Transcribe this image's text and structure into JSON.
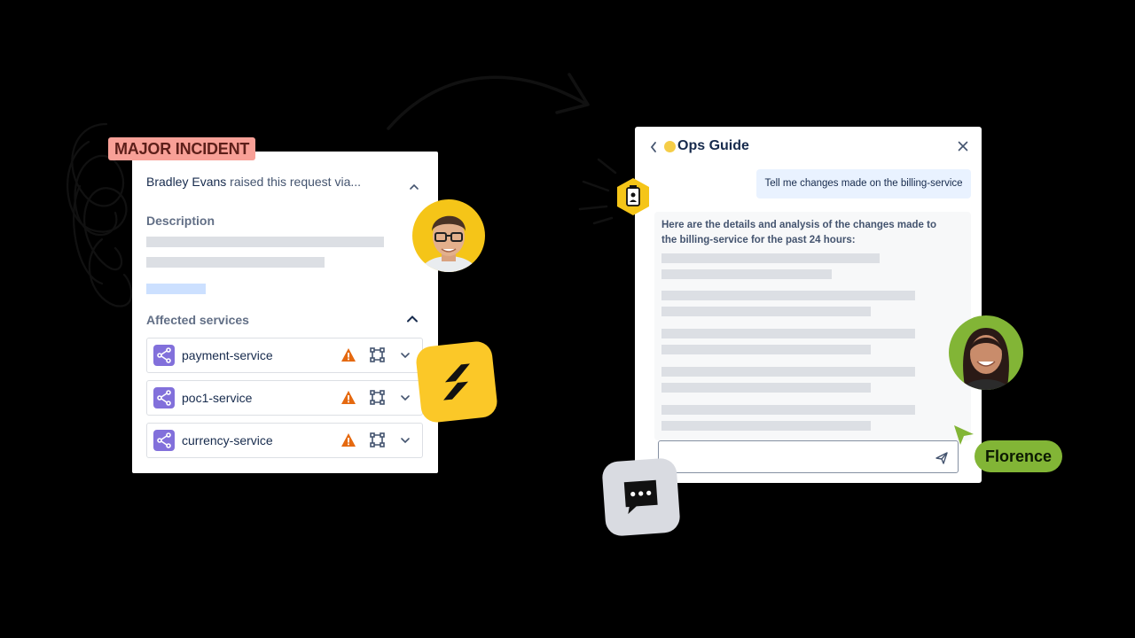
{
  "incident": {
    "badge": "MAJOR INCIDENT",
    "raised_by_name": "Bradley Evans",
    "raised_by_rest": " raised this request via...",
    "description_label": "Description",
    "affected_label": "Affected services",
    "services": [
      {
        "name": "payment-service"
      },
      {
        "name": "poc1-service"
      },
      {
        "name": "currency-service"
      }
    ]
  },
  "ops_guide": {
    "title": "Ops Guide",
    "user_message": "Tell me changes made on the billing-service",
    "ai_message": "Here are the details and analysis of the changes made to the billing-service for the past 24 hours:"
  },
  "florence": {
    "name": "Florence"
  },
  "colors": {
    "background": "#000000",
    "badge": "#f8a097",
    "service_icon": "#8270db",
    "warning": "#e56910",
    "florence_tag": "#82b536",
    "bolt_tile": "#fbc828",
    "user_bubble": "#e9f2ff"
  },
  "icons": [
    "chevron-up-icon",
    "service-icon",
    "warning-icon",
    "dependency-graph-icon",
    "chevron-down-icon",
    "back-icon",
    "close-icon",
    "send-icon",
    "cursor-icon",
    "lightning-icon",
    "chat-icon",
    "robot-badge-icon"
  ]
}
